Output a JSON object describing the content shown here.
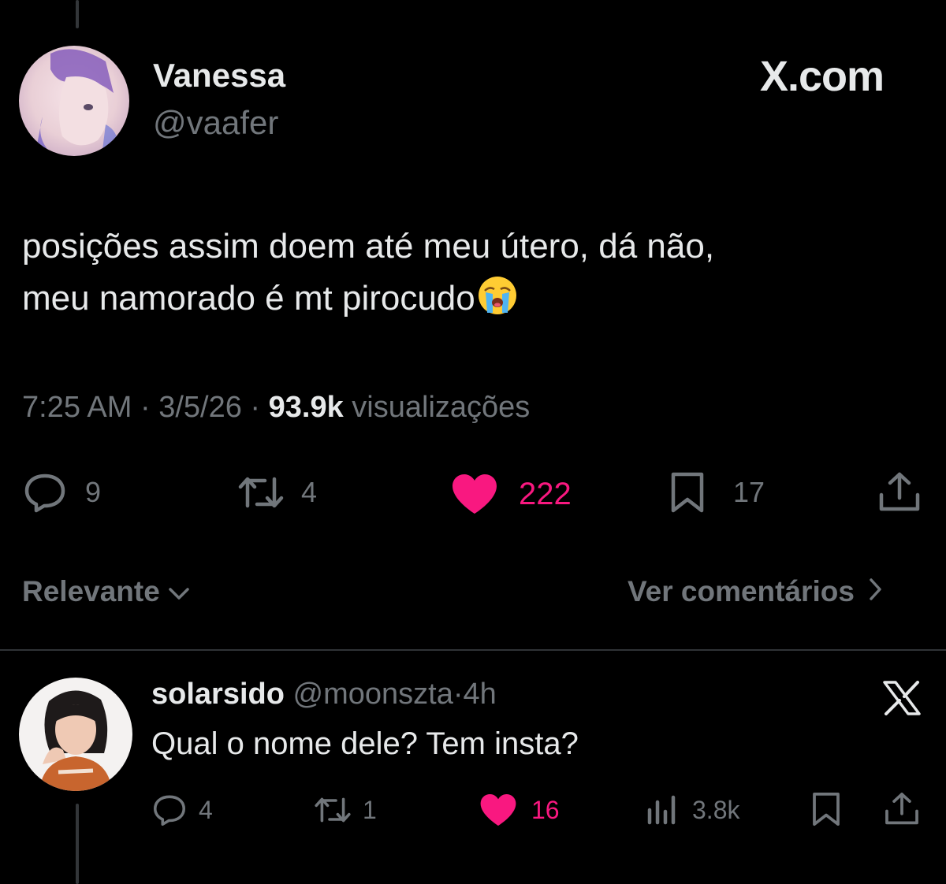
{
  "main_tweet": {
    "display_name": "Vanessa",
    "handle": "@vaafer",
    "brand": "X.com",
    "text_lines": [
      "posições assim doem até meu útero, dá não,",
      "meu namorado é mt pirocudo"
    ],
    "emoji": "crying-face",
    "time": "7:25 AM",
    "date": "3/5/26",
    "views_count": "93.9k",
    "views_label": "visualizações",
    "separator": "·",
    "actions": {
      "replies": "9",
      "reposts": "4",
      "likes": "222",
      "bookmarks": "17"
    }
  },
  "sort_bar": {
    "sort_label": "Relevante",
    "comments_label": "Ver comentários"
  },
  "reply": {
    "display_name": "solarsido",
    "handle": "@moonszta",
    "separator": "·",
    "age": "4h",
    "text": "Qual o nome dele? Tem insta?",
    "actions": {
      "replies": "4",
      "reposts": "1",
      "likes": "16",
      "views": "3.8k"
    }
  },
  "colors": {
    "background": "#000000",
    "primary_text": "#e7e9ea",
    "secondary_text": "#71767b",
    "like_pink": "#f91880",
    "divider": "#2f3336"
  },
  "icons": {
    "reply": "reply-bubble-icon",
    "repost": "repost-icon",
    "like": "heart-filled-icon",
    "bookmark": "bookmark-icon",
    "share": "share-icon",
    "views": "analytics-bars-icon",
    "x_logo": "x-logo-icon",
    "chevron_down": "chevron-down-icon",
    "chevron_right": "chevron-right-icon"
  }
}
